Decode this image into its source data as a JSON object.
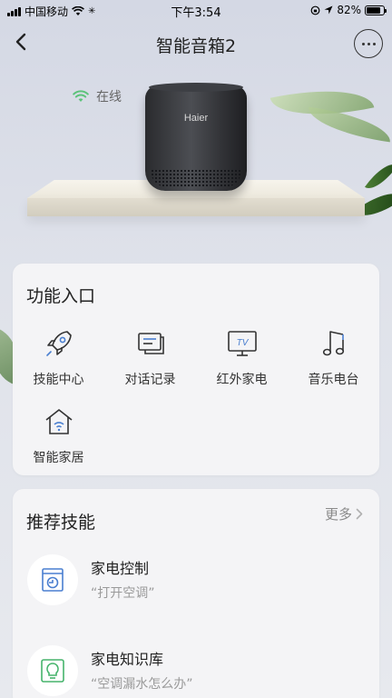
{
  "status_bar": {
    "carrier": "中国移动",
    "time": "下午3:54",
    "battery": "82%",
    "battery_level": 0.82
  },
  "nav": {
    "title": "智能音箱2",
    "back_icon": "chevron-left-icon",
    "more_icon": "ellipsis-icon"
  },
  "hero": {
    "status": "在线",
    "brand": "Haier"
  },
  "functions": {
    "title": "功能入口",
    "items": [
      {
        "label": "技能中心",
        "icon": "rocket-icon"
      },
      {
        "label": "对话记录",
        "icon": "chat-record-icon"
      },
      {
        "label": "红外家电",
        "icon": "tv-icon",
        "icon_text": "TV"
      },
      {
        "label": "音乐电台",
        "icon": "music-note-icon"
      },
      {
        "label": "智能家居",
        "icon": "smart-home-icon"
      }
    ]
  },
  "recommend": {
    "title": "推荐技能",
    "more_label": "更多",
    "skills": [
      {
        "name": "家电控制",
        "example": "“打开空调”",
        "icon": "appliance-control-icon"
      },
      {
        "name": "家电知识库",
        "example": "“空调漏水怎么办”",
        "icon": "lightbulb-icon"
      }
    ]
  },
  "colors": {
    "accent_blue": "#4a7fd0",
    "accent_green": "#46b46c",
    "wifi_green": "#5cc37a",
    "card_bg": "#f4f4f6",
    "page_bg": "#d8dbe4"
  }
}
